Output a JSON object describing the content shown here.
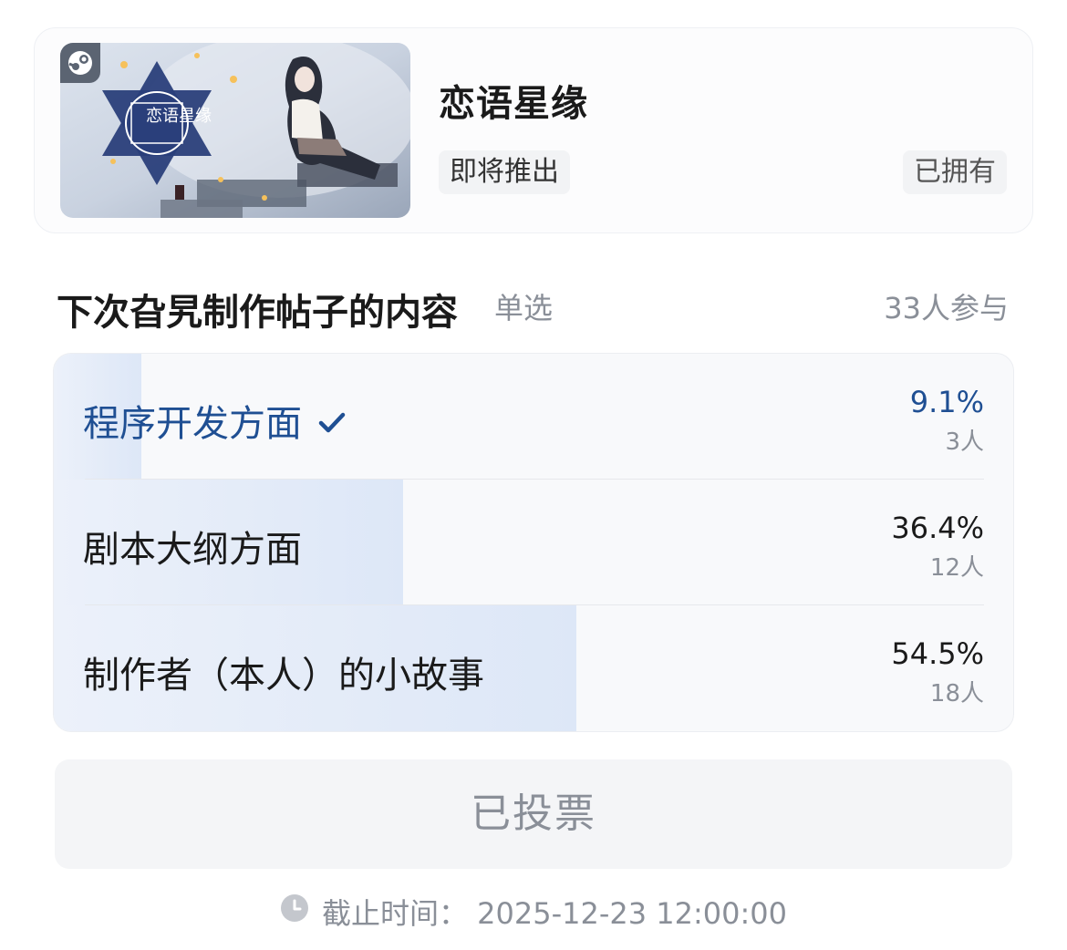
{
  "game": {
    "title": "恋语星缘",
    "status_tag": "即将推出",
    "ownership_tag": "已拥有",
    "cover_logo_text": "恋语星缘",
    "platform_icon": "steam-icon"
  },
  "poll": {
    "title": "下次旮旯制作帖子的内容",
    "mode": "单选",
    "participants": "33人参与",
    "options": [
      {
        "label": "程序开发方面",
        "percent": "9.1%",
        "votes": "3人",
        "share": 0.091,
        "selected": true
      },
      {
        "label": "剧本大纲方面",
        "percent": "36.4%",
        "votes": "12人",
        "share": 0.364,
        "selected": false
      },
      {
        "label": "制作者（本人）的小故事",
        "percent": "54.5%",
        "votes": "18人",
        "share": 0.545,
        "selected": false
      }
    ],
    "voted_label": "已投票",
    "deadline": "截止时间：  2025-12-23 12:00:00"
  },
  "colors": {
    "accent": "#1f4f93",
    "bar_start": "#ecf1fa",
    "bar_end": "#dde7f7",
    "muted_text": "#8a8f98"
  }
}
